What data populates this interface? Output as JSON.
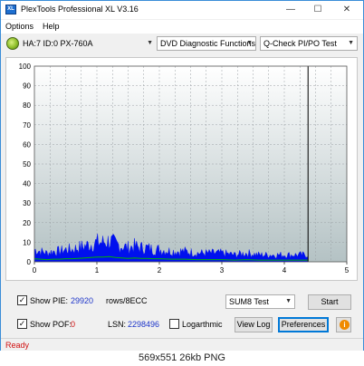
{
  "window": {
    "title": "PlexTools Professional XL V3.16",
    "icon_label": "XL",
    "minimize_label": "—",
    "maximize_label": "☐",
    "close_label": "✕"
  },
  "menu": {
    "options": "Options",
    "help": "Help"
  },
  "toolbar": {
    "drive": "HA:7 ID:0  PX-760A",
    "function": "DVD Diagnostic Functions",
    "test": "Q-Check PI/PO Test"
  },
  "chart_data": {
    "type": "area",
    "xlim": [
      0,
      5
    ],
    "ylim": [
      0,
      100
    ],
    "x_ticks": [
      "0",
      "1",
      "2",
      "3",
      "4",
      "5"
    ],
    "y_ticks": [
      "0",
      "10",
      "20",
      "30",
      "40",
      "50",
      "60",
      "70",
      "80",
      "90",
      "100"
    ],
    "end_marker_x": 4.38,
    "grid": true,
    "colors": {
      "pie": "#0010ee",
      "average": "#00b400",
      "end_line": "#000000"
    },
    "series": [
      {
        "x": [
          0.0,
          0.1,
          0.2,
          0.3,
          0.4,
          0.5,
          0.6,
          0.7,
          0.8,
          0.9,
          1.0,
          1.1,
          1.2,
          1.3,
          1.4,
          1.5,
          1.6,
          1.7,
          1.8,
          1.9,
          2.0,
          2.2,
          2.4,
          2.6,
          2.8,
          3.0,
          3.2,
          3.4,
          3.6,
          3.8,
          4.0,
          4.2,
          4.38
        ],
        "values": [
          7,
          6,
          5,
          6,
          6,
          7,
          7,
          8,
          9,
          10,
          11,
          11,
          12,
          10,
          9,
          8,
          9,
          8,
          8,
          7,
          7,
          6,
          6,
          5,
          5,
          5,
          4,
          5,
          4,
          4,
          4,
          4,
          4
        ]
      }
    ]
  },
  "bottom": {
    "show_pie_label": "Show PIE:",
    "pie_value": "29920",
    "pie_unit": "rows/8ECC",
    "show_pof_label": "Show POF:",
    "pof_value": "0",
    "lsn_label": "LSN:",
    "lsn_value": "2298496",
    "logarithmic_label": "Logarthmic",
    "sum_select": "SUM8 Test",
    "start_label": "Start",
    "view_log_label": "View Log",
    "preferences_label": "Preferences"
  },
  "status": {
    "text": "Ready"
  },
  "caption": "569x551  26kb  PNG"
}
